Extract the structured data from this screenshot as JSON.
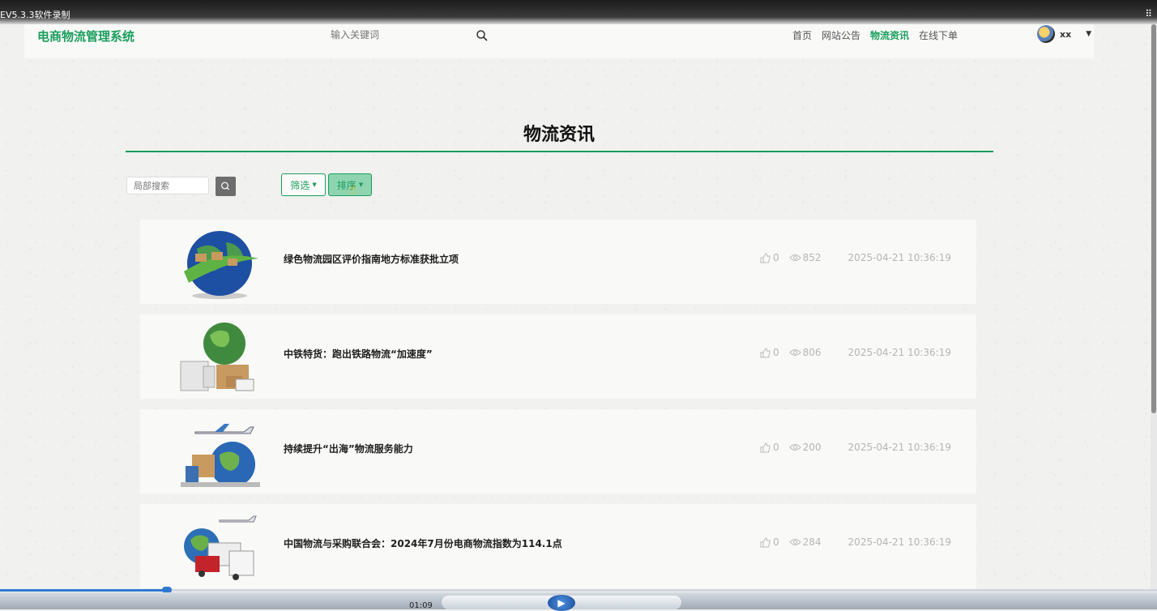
{
  "recorder": {
    "title": "EV5.3.3软件录制",
    "time": "01:09"
  },
  "site": {
    "logo": "电商物流管理系统",
    "search_placeholder": "输入关键词",
    "nav": [
      {
        "label": "首页",
        "active": false
      },
      {
        "label": "网站公告",
        "active": false
      },
      {
        "label": "物流资讯",
        "active": true
      },
      {
        "label": "在线下单",
        "active": false
      }
    ],
    "user": "xx",
    "accent": "#1a9e5d"
  },
  "page": {
    "title": "物流资讯",
    "local_search_placeholder": "局部搜索",
    "filter_label": "筛选",
    "sort_label": "排序"
  },
  "articles": [
    {
      "title": "绿色物流园区评价指南地方标准获批立项",
      "likes": "0",
      "views": "852",
      "date": "2025-04-21 10:36:19"
    },
    {
      "title": "中铁特货：跑出铁路物流“加速度”",
      "likes": "0",
      "views": "806",
      "date": "2025-04-21 10:36:19"
    },
    {
      "title": "持续提升“出海”物流服务能力",
      "likes": "0",
      "views": "200",
      "date": "2025-04-21 10:36:19"
    },
    {
      "title": "中国物流与采购联合会：2024年7月份电商物流指数为114.1点",
      "likes": "0",
      "views": "284",
      "date": "2025-04-21 10:36:19"
    }
  ]
}
